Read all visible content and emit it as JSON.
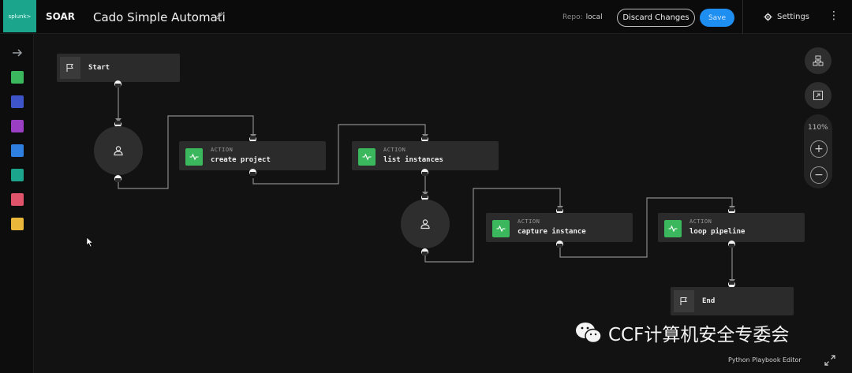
{
  "topbar": {
    "logo_text": "splunk>",
    "product": "SOAR",
    "playbook_title": "Cado Simple Automati",
    "repo_label": "Repo:",
    "repo_value": "local",
    "discard_label": "Discard Changes",
    "save_label": "Save",
    "settings_label": "Settings"
  },
  "rail": {
    "tools": [
      {
        "name": "action-tool",
        "color": "#3bb85d"
      },
      {
        "name": "code-tool",
        "color": "#3d55c9"
      },
      {
        "name": "utility-tool",
        "color": "#9a3fc4"
      },
      {
        "name": "filter-tool",
        "color": "#2f7fe0"
      },
      {
        "name": "decision-tool",
        "color": "#1aa58c"
      },
      {
        "name": "format-tool",
        "color": "#e0546b"
      },
      {
        "name": "prompt-tool",
        "color": "#e9b73a"
      }
    ]
  },
  "nodes": {
    "start_label": "Start",
    "end_label": "End",
    "action_kicker": "ACTION",
    "create_project": "create project",
    "list_instances": "list instances",
    "capture_instance": "capture instance",
    "loop_pipeline": "loop pipeline"
  },
  "controls": {
    "zoom_level": "110%"
  },
  "footer": {
    "editor_label": "Python Playbook Editor"
  },
  "watermark": {
    "text": "CCF计算机安全专委会"
  }
}
